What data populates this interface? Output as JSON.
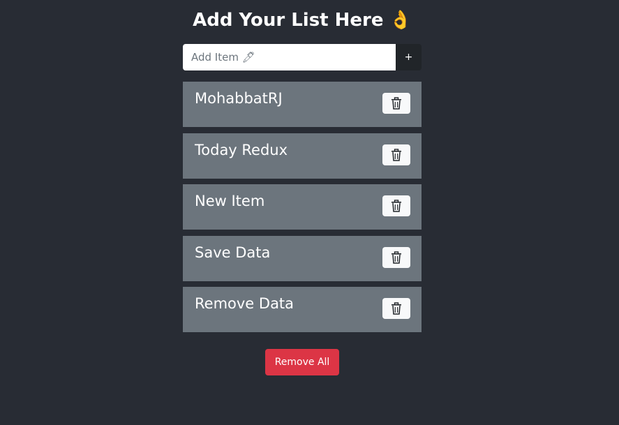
{
  "header": {
    "title": "Add Your List Here",
    "emoji": "👌"
  },
  "add_form": {
    "placeholder": "Add Item 🖊",
    "value": "",
    "add_label": "+"
  },
  "items": [
    {
      "label": "MohabbatRJ"
    },
    {
      "label": "Today Redux"
    },
    {
      "label": "New Item"
    },
    {
      "label": "Save Data"
    },
    {
      "label": "Remove Data"
    }
  ],
  "actions": {
    "remove_all_label": "Remove All"
  },
  "icons": {
    "delete": "trash-icon"
  },
  "colors": {
    "background": "#282c34",
    "item_background": "#6c757d",
    "add_button": "#212529",
    "delete_button": "#f8f9fa",
    "remove_all": "#dc3545"
  }
}
